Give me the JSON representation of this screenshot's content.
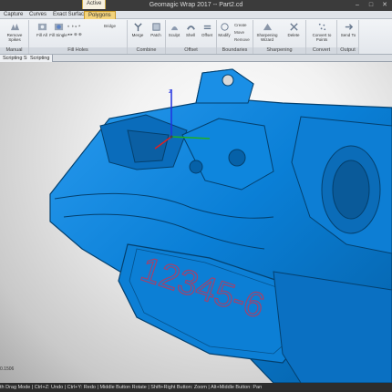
{
  "window": {
    "title": "Geomagic Wrap 2017 -- Part2.cd",
    "active_tag": "Active",
    "minimize": "–",
    "maximize": "□",
    "close": "✕"
  },
  "tabs": [
    {
      "label": "Capture"
    },
    {
      "label": "Curves"
    },
    {
      "label": "Exact Surfaces"
    },
    {
      "label": "Polygons",
      "active": true
    }
  ],
  "ribbon": {
    "groups": [
      {
        "label": "Manual",
        "buttons": [
          "Remove Spikes"
        ]
      },
      {
        "label": "Fill Holes",
        "buttons": [
          "Fill All",
          "Fill Single"
        ],
        "small": [
          "Bridge"
        ]
      },
      {
        "label": "Combine",
        "buttons": [
          "Merge",
          "Patch"
        ]
      },
      {
        "label": "Offset",
        "buttons": [
          "Sculpt",
          "Shell",
          "Offset"
        ]
      },
      {
        "label": "Boundaries",
        "buttons": [
          "Modify"
        ],
        "small": [
          "Create",
          "Move",
          "Remove"
        ]
      },
      {
        "label": "Sharpening",
        "buttons": [
          "Sharpening Wizard",
          "Delete"
        ]
      },
      {
        "label": "Convert",
        "buttons": [
          "Convert to Points"
        ]
      },
      {
        "label": "Output",
        "buttons": [
          "Send To"
        ]
      }
    ]
  },
  "op_tabs": [
    "Scripting Started",
    "Scripting"
  ],
  "viewport": {
    "embossed_text": "12345-6",
    "coord_readout": "0.1506",
    "colors": {
      "mesh": "#0a7fd6",
      "mesh_dark": "#04406e",
      "text": "#a0436e"
    }
  },
  "axes": {
    "x_color": "#e02020",
    "y_color": "#20b020",
    "z_color": "#2030e0"
  },
  "statusbar": "th Drag Mode | Ctrl+Z: Undo | Ctrl+Y: Redo | Middle Button Rotate | Shift+Right Button: Zoom | Alt+Middle Button: Pan"
}
